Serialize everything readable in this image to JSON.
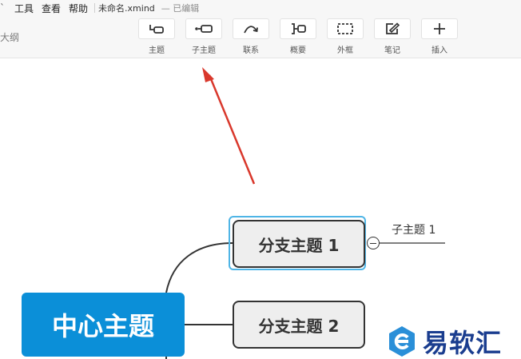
{
  "menu": {
    "items": [
      "工具",
      "查看",
      "帮助"
    ],
    "file_name": "未命名.xmind",
    "status": "— 已编辑"
  },
  "sidebar": {
    "outline_label": "大纲"
  },
  "toolbar": {
    "buttons": [
      {
        "label": "主题",
        "icon": "topic-icon"
      },
      {
        "label": "子主题",
        "icon": "subtopic-icon"
      },
      {
        "label": "联系",
        "icon": "relationship-icon"
      },
      {
        "label": "概要",
        "icon": "summary-icon"
      },
      {
        "label": "外框",
        "icon": "boundary-icon"
      },
      {
        "label": "笔记",
        "icon": "note-icon"
      },
      {
        "label": "插入",
        "icon": "plus-icon"
      }
    ]
  },
  "mindmap": {
    "central_topic": "中心主题",
    "branches": [
      {
        "label": "分支主题 1",
        "selected": true
      },
      {
        "label": "分支主题 2",
        "selected": false
      }
    ],
    "subtopics": [
      "子主题 1"
    ]
  },
  "watermark": {
    "text": "易软汇",
    "icon": "e-logo-icon"
  },
  "colors": {
    "central_fill": "#0b8fd8",
    "selection_outline": "#4fb5e6",
    "annotation_arrow": "#d9382c",
    "watermark": "#1a3d8f"
  }
}
